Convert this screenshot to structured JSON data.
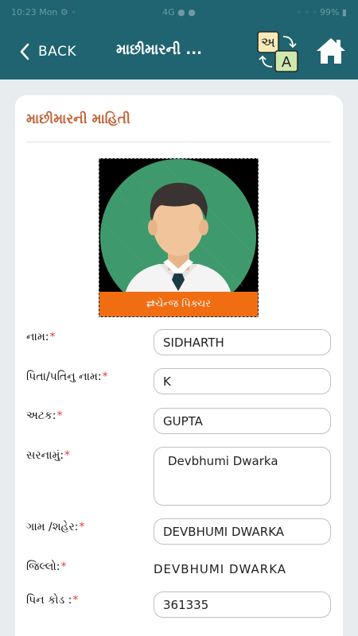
{
  "status_bar": {
    "left": "10:23  Mon ⚙ ◦",
    "center": "4G ● ●",
    "right": "◦ ◦ ◦  99% ▮"
  },
  "header": {
    "back_label": "BACK",
    "title": "માછીમારની ...",
    "lang_icon_letters": {
      "source": "અ",
      "target": "A"
    },
    "icons": {
      "back": "chevron-left-icon",
      "language": "translate-icon",
      "home": "home-icon"
    }
  },
  "card": {
    "title": "માછીમારની માહિતી",
    "photo": {
      "change_label": "⇄ચેન્જ પિક્ચર"
    },
    "fields": {
      "name": {
        "label": "નામ:",
        "required": "*",
        "value": "SIDHARTH"
      },
      "father_husband_name": {
        "label": "પિતા/પતિનુ નામ:",
        "required": "*",
        "value": "K"
      },
      "surname": {
        "label": "અટક:",
        "required": "*",
        "value": "GUPTA"
      },
      "address": {
        "label": "સરનામું:",
        "required": "*",
        "value": "Devbhumi Dwarka"
      },
      "village_city": {
        "label": "ગામ /શહેર:",
        "required": "*",
        "value": "DEVBHUMI DWARKA"
      },
      "district": {
        "label": "જિલ્લો:",
        "required": "*",
        "value": "DEVBHUMI DWARKA"
      },
      "pincode": {
        "label": "પિન કોડ :",
        "required": "*",
        "value": "361335"
      }
    }
  },
  "colors": {
    "appbar": "#1f6470",
    "accent": "#c0653a",
    "change_pic_bg": "#f16d12",
    "required": "#e53935"
  }
}
